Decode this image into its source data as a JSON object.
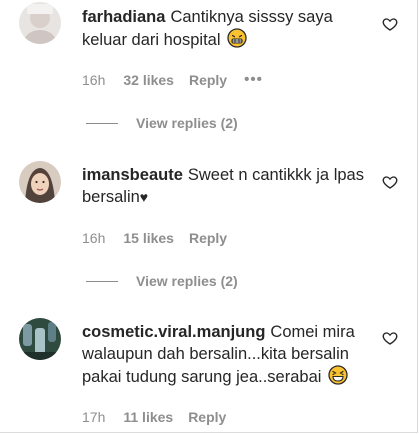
{
  "comments": [
    {
      "username": "farhadiana",
      "text": "Cantiknya sisssy saya keluar dari hospital",
      "emoji": "grimacing-face",
      "time": "16h",
      "likes": "32 likes",
      "reply": "Reply",
      "more": "•••",
      "view_replies": "View replies (2)"
    },
    {
      "username": "imansbeaute",
      "text": "Sweet n cantikkk ja lpas bersalin",
      "heart_char": "♥",
      "time": "16h",
      "likes": "15 likes",
      "reply": "Reply",
      "view_replies": "View replies (2)"
    },
    {
      "username": "cosmetic.viral.manjung",
      "text": "Comei mira walaupun dah bersalin...kita bersalin pakai tudung sarung jea..serabai",
      "emoji": "laughing-face",
      "time": "17h",
      "likes": "11 likes",
      "reply": "Reply"
    }
  ],
  "colors": {
    "text": "#262626",
    "secondary": "#8e8e8e",
    "emoji_yellow": "#f9c22e"
  }
}
